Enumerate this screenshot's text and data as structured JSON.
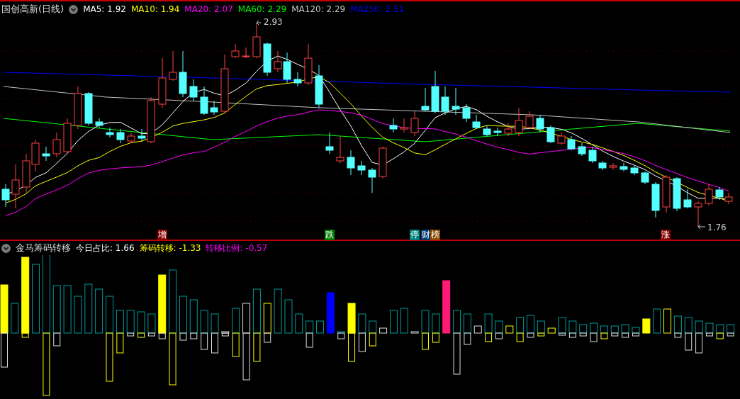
{
  "chart_title": "国创高新(日线)",
  "ma_legend": [
    {
      "label": "MA5: 1.92",
      "color": "#ffffff"
    },
    {
      "label": "MA10: 1.94",
      "color": "#ffff00"
    },
    {
      "label": "MA20: 2.07",
      "color": "#ff00ff"
    },
    {
      "label": "MA60: 2.29",
      "color": "#00ff00"
    },
    {
      "label": "MA120: 2.29",
      "color": "#c0c0c0"
    },
    {
      "label": "MA250: 2.51",
      "color": "#0000ff"
    }
  ],
  "high_label": "2.93",
  "low_label": "1.76",
  "signal_markers": [
    {
      "text": "增",
      "color": "#8b0000"
    },
    {
      "text": "跌",
      "color": "#008000"
    },
    {
      "text": "停",
      "color": "#007f7f"
    },
    {
      "text": "财",
      "color": "#003b73"
    },
    {
      "text": "榜",
      "color": "#8b4a00"
    },
    {
      "text": "涨",
      "color": "#8b0000"
    }
  ],
  "indicator": {
    "title": "金马筹码转移",
    "values": [
      {
        "label": "今日占比: 1.66",
        "color": "#ffffff"
      },
      {
        "label": "筹码转移: -1.33",
        "color": "#ffff00"
      },
      {
        "label": "转移比例: -0.57",
        "color": "#ff00ff"
      }
    ]
  }
}
